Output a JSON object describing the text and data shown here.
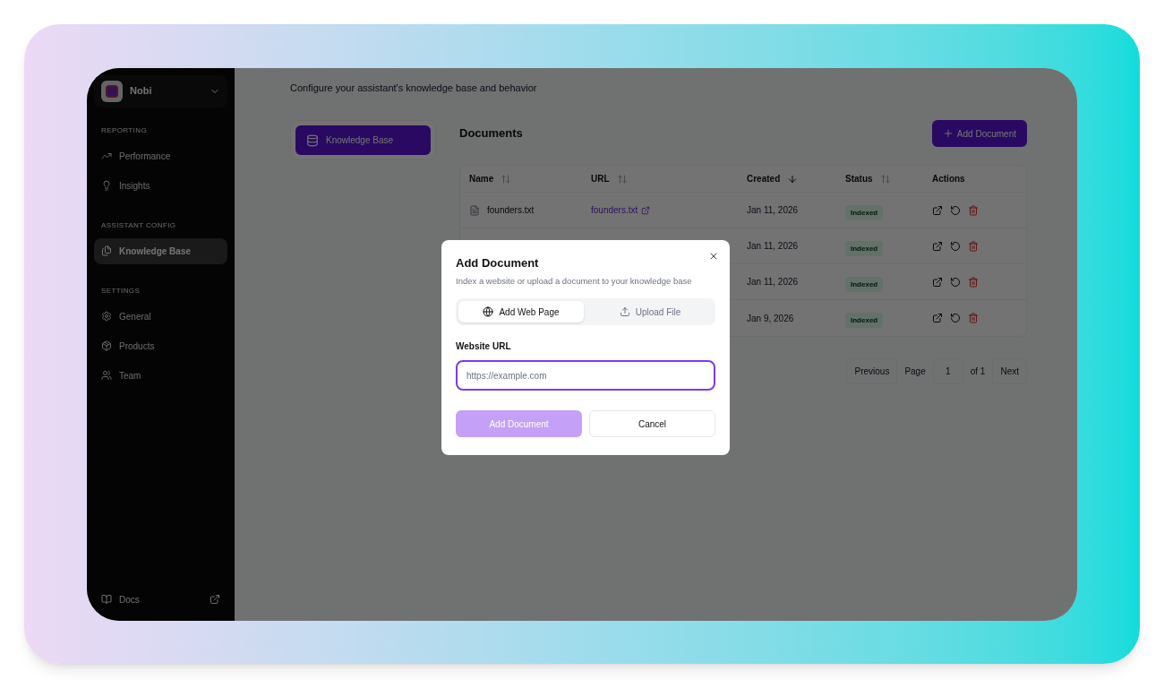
{
  "sidebar": {
    "workspace": "Nobi",
    "sections": [
      {
        "heading": "REPORTING",
        "items": [
          {
            "label": "Performance",
            "selected": false
          },
          {
            "label": "Insights",
            "selected": false
          }
        ]
      },
      {
        "heading": "ASSISTANT CONFIG",
        "items": [
          {
            "label": "Knowledge Base",
            "selected": true
          }
        ]
      },
      {
        "heading": "SETTINGS",
        "items": [
          {
            "label": "General",
            "selected": false
          },
          {
            "label": "Products",
            "selected": false
          },
          {
            "label": "Team",
            "selected": false
          }
        ]
      }
    ],
    "footer": {
      "label": "Docs"
    }
  },
  "page": {
    "subtitle": "Configure your assistant's knowledge base and behavior",
    "tabs": [
      {
        "label": "Knowledge Base",
        "selected": true
      }
    ]
  },
  "documents": {
    "title": "Documents",
    "add_button": "Add Document",
    "columns": [
      "Name",
      "URL",
      "Created",
      "Status",
      "Actions"
    ],
    "rows": [
      {
        "name": "founders.txt",
        "url": "founders.txt",
        "created": "Jan 11, 2026",
        "status": "Indexed"
      },
      {
        "created": "Jan 11, 2026",
        "status": "Indexed"
      },
      {
        "created": "Jan 11, 2026",
        "status": "Indexed"
      },
      {
        "created": "Jan 9, 2026",
        "status": "Indexed"
      }
    ],
    "pagination": {
      "previous": "Previous",
      "page_label": "Page",
      "page": "1",
      "of": "of 1",
      "next": "Next"
    }
  },
  "dialog": {
    "title": "Add Document",
    "description": "Index a website or upload a document to your knowledge base",
    "tabs": [
      {
        "label": "Add Web Page",
        "selected": true
      },
      {
        "label": "Upload File",
        "selected": false
      }
    ],
    "field_label": "Website URL",
    "placeholder": "https://example.com",
    "submit": "Add Document",
    "submit_disabled": true,
    "cancel": "Cancel"
  }
}
